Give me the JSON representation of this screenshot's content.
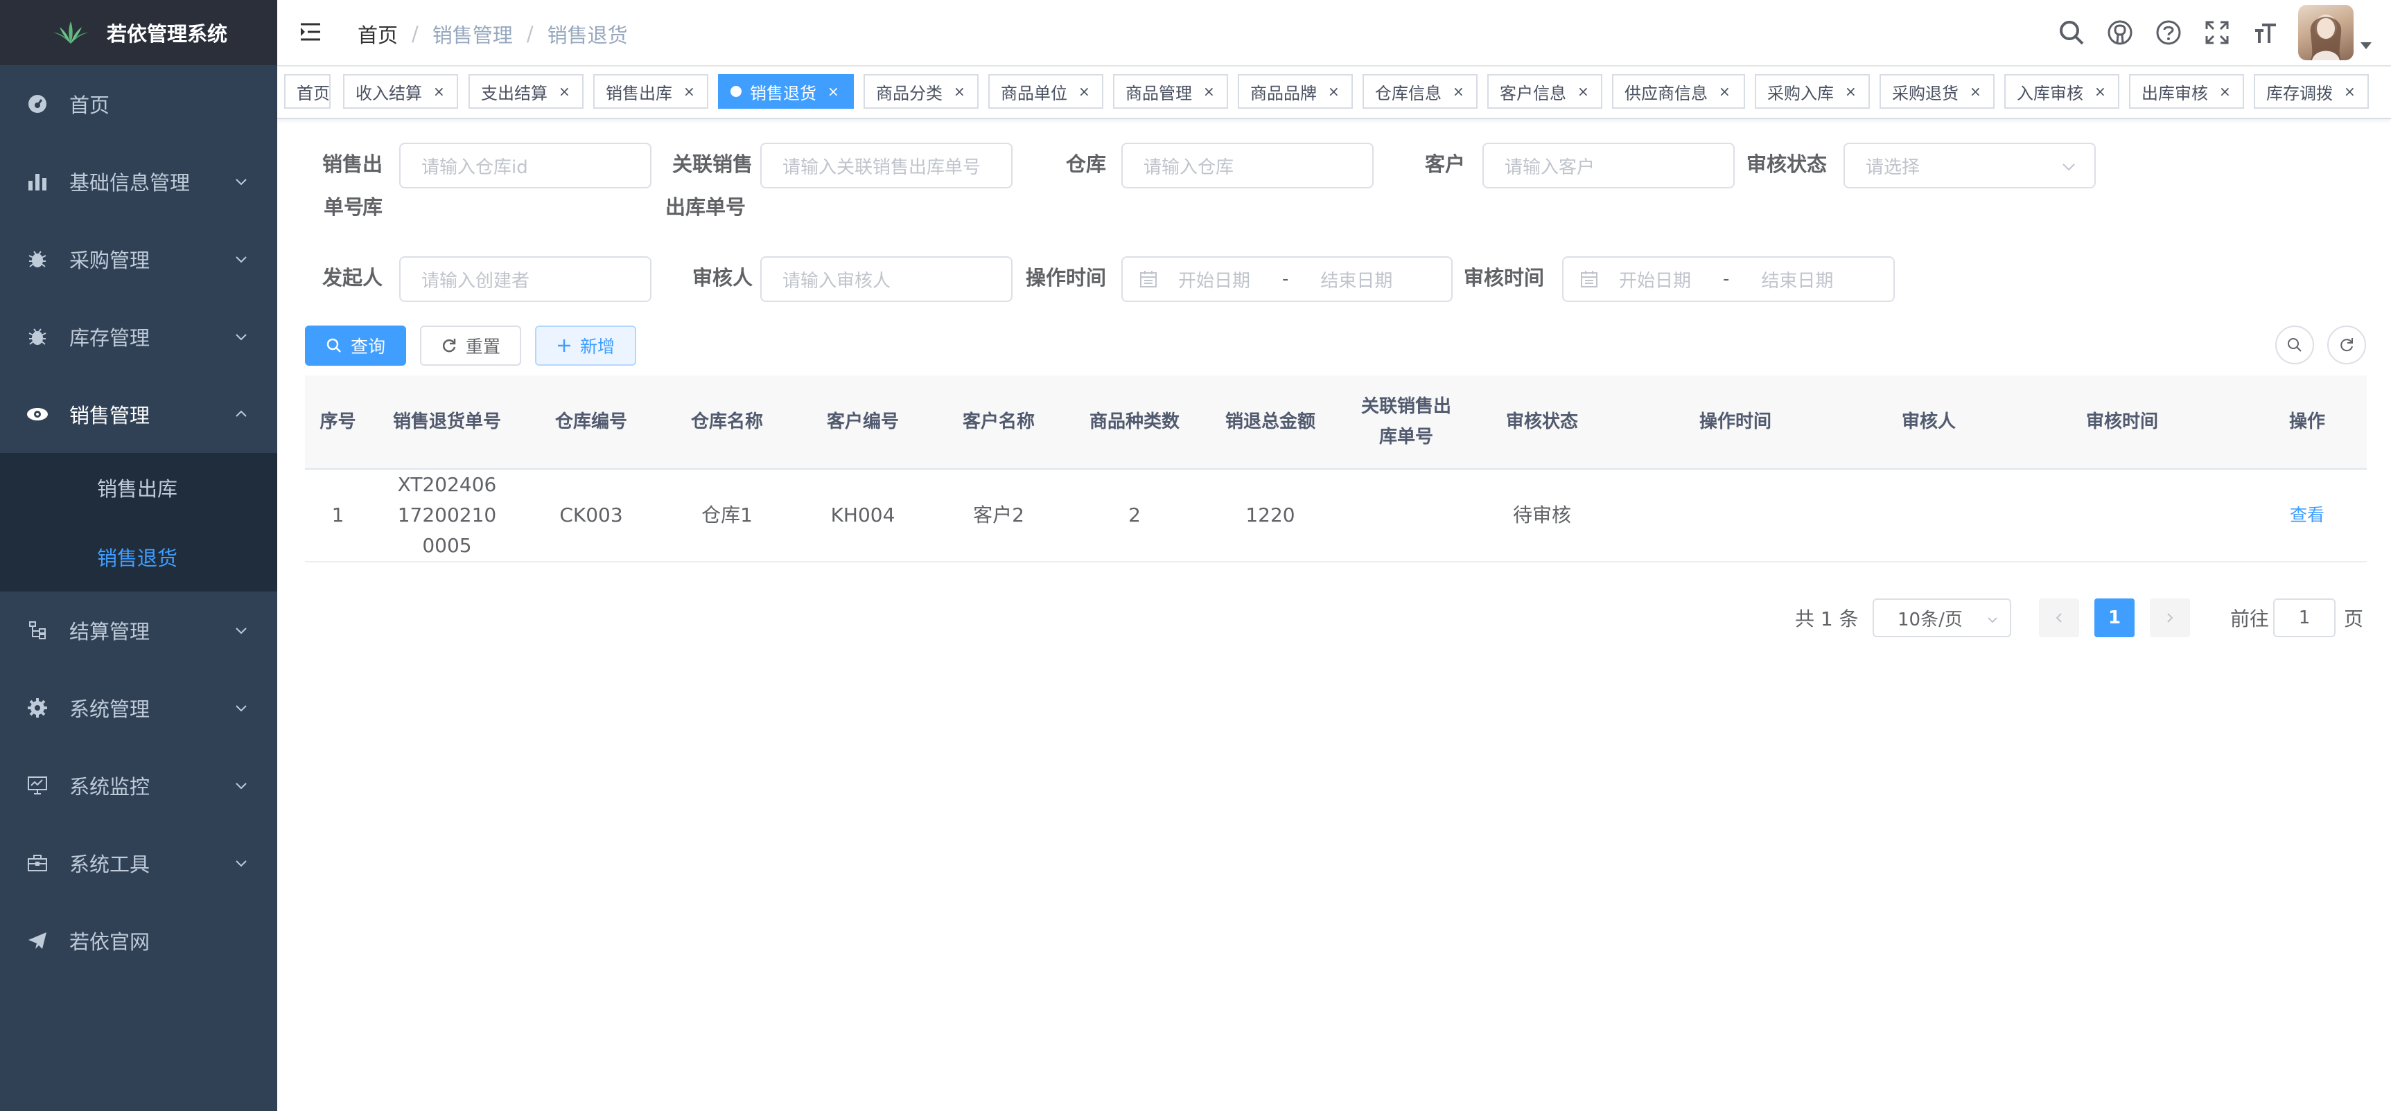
{
  "app": {
    "title": "若依管理系统"
  },
  "sidebar": {
    "items": [
      {
        "label": "首页",
        "icon": "dashboard-icon"
      },
      {
        "label": "基础信息管理",
        "icon": "chart-icon"
      },
      {
        "label": "采购管理",
        "icon": "bug-icon"
      },
      {
        "label": "库存管理",
        "icon": "bug-icon"
      },
      {
        "label": "销售管理",
        "icon": "eye-icon",
        "expanded": true
      },
      {
        "label": "结算管理",
        "icon": "tree-icon"
      },
      {
        "label": "系统管理",
        "icon": "gear-icon"
      },
      {
        "label": "系统监控",
        "icon": "monitor-icon"
      },
      {
        "label": "系统工具",
        "icon": "toolbox-icon"
      },
      {
        "label": "若依官网",
        "icon": "send-icon"
      }
    ],
    "sub_items": [
      {
        "label": "销售出库",
        "active": false
      },
      {
        "label": "销售退货",
        "active": true
      }
    ]
  },
  "breadcrumb": [
    "首页",
    "销售管理",
    "销售退货"
  ],
  "tags": [
    {
      "label": "首页",
      "closable": false,
      "active": false
    },
    {
      "label": "收入结算",
      "closable": true,
      "active": false
    },
    {
      "label": "支出结算",
      "closable": true,
      "active": false
    },
    {
      "label": "销售出库",
      "closable": true,
      "active": false
    },
    {
      "label": "销售退货",
      "closable": true,
      "active": true
    },
    {
      "label": "商品分类",
      "closable": true,
      "active": false
    },
    {
      "label": "商品单位",
      "closable": true,
      "active": false
    },
    {
      "label": "商品管理",
      "closable": true,
      "active": false
    },
    {
      "label": "商品品牌",
      "closable": true,
      "active": false
    },
    {
      "label": "仓库信息",
      "closable": true,
      "active": false
    },
    {
      "label": "客户信息",
      "closable": true,
      "active": false
    },
    {
      "label": "供应商信息",
      "closable": true,
      "active": false
    },
    {
      "label": "采购入库",
      "closable": true,
      "active": false
    },
    {
      "label": "采购退货",
      "closable": true,
      "active": false
    },
    {
      "label": "入库审核",
      "closable": true,
      "active": false
    },
    {
      "label": "出库审核",
      "closable": true,
      "active": false
    },
    {
      "label": "库存调拨",
      "closable": true,
      "active": false
    }
  ],
  "tag_close_glyph": "×",
  "form": {
    "sales_out_no": {
      "label_line1": "销售出库",
      "label_line2": "单号",
      "placeholder": "请输入仓库id"
    },
    "linked_no": {
      "label_line1": "关联销售",
      "label_line2": "出库单号",
      "placeholder": "请输入关联销售出库单号"
    },
    "warehouse": {
      "label": "仓库",
      "placeholder": "请输入仓库"
    },
    "customer": {
      "label": "客户",
      "placeholder": "请输入客户"
    },
    "audit_status": {
      "label": "审核状态",
      "placeholder": "请选择"
    },
    "initiator": {
      "label": "发起人",
      "placeholder": "请输入创建者"
    },
    "auditor": {
      "label": "审核人",
      "placeholder": "请输入审核人"
    },
    "op_time": {
      "label": "操作时间",
      "start": "开始日期",
      "sep": "-",
      "end": "结束日期"
    },
    "audit_time": {
      "label": "审核时间",
      "start": "开始日期",
      "sep": "-",
      "end": "结束日期"
    }
  },
  "actions": {
    "search": "查询",
    "reset": "重置",
    "add": "新增"
  },
  "table": {
    "headers": [
      "序号",
      "销售退货单号",
      "仓库编号",
      "仓库名称",
      "客户编号",
      "客户名称",
      "商品种类数",
      "销退总金额",
      "关联销售出库单号",
      "审核状态",
      "操作时间",
      "审核人",
      "审核时间",
      "操作"
    ],
    "rows": [
      {
        "index": "1",
        "return_no": "XT202406172002100005",
        "warehouse_code": "CK003",
        "warehouse_name": "仓库1",
        "customer_code": "KH004",
        "customer_name": "客户2",
        "item_kinds": "2",
        "total_amount": "1220",
        "linked_no": "",
        "status": "待审核",
        "op_time": "",
        "auditor": "",
        "audit_time": "",
        "action": "查看"
      }
    ]
  },
  "pagination": {
    "total": "共 1 条",
    "page_size": "10条/页",
    "current": "1",
    "goto_label": "前往",
    "goto_value": "1",
    "page_label": "页"
  },
  "colors": {
    "primary": "#409eff",
    "sidebar_bg": "#304156",
    "active_tag": "#42b983"
  }
}
